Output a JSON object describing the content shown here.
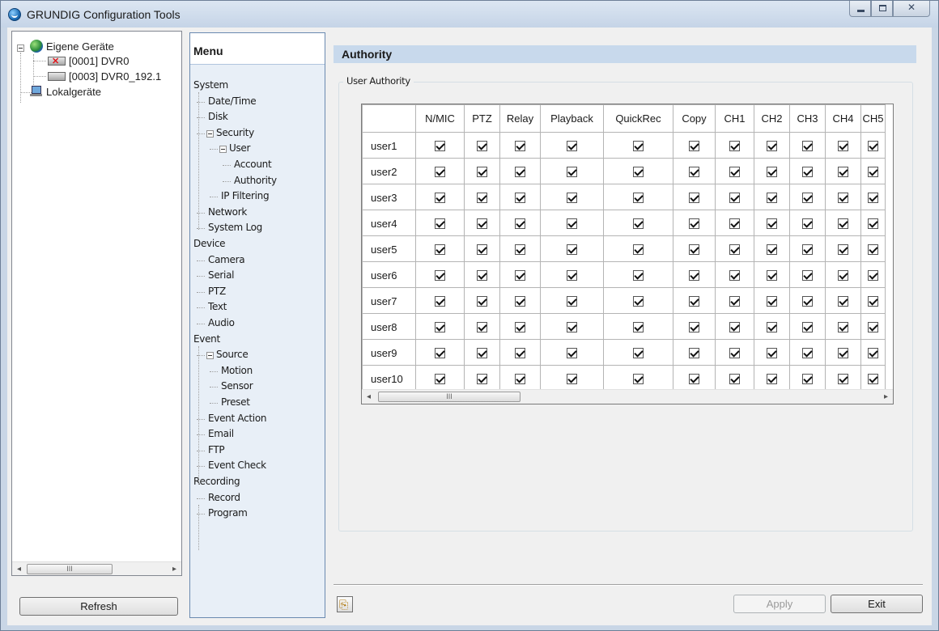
{
  "window": {
    "title": "GRUNDIG Configuration Tools"
  },
  "device_tree": {
    "root": "Eigene Geräte",
    "devices": [
      {
        "label": "[0001] DVR0",
        "status": "error"
      },
      {
        "label": "[0003] DVR0_192.1",
        "status": "ok"
      }
    ],
    "local": "Lokalgeräte",
    "scroll_thumb": "III",
    "refresh_label": "Refresh"
  },
  "menu": {
    "header": "Menu",
    "items": [
      {
        "label": "System",
        "level": 0
      },
      {
        "label": "Date/Time",
        "level": 1
      },
      {
        "label": "Disk",
        "level": 1
      },
      {
        "label": "Security",
        "level": 1
      },
      {
        "label": "User",
        "level": 2
      },
      {
        "label": "Account",
        "level": 3
      },
      {
        "label": "Authority",
        "level": 3
      },
      {
        "label": "IP Filtering",
        "level": 2
      },
      {
        "label": "Network",
        "level": 1
      },
      {
        "label": "System Log",
        "level": 1
      },
      {
        "label": "Device",
        "level": 0
      },
      {
        "label": "Camera",
        "level": 1
      },
      {
        "label": "Serial",
        "level": 1
      },
      {
        "label": "PTZ",
        "level": 1
      },
      {
        "label": "Text",
        "level": 1
      },
      {
        "label": "Audio",
        "level": 1
      },
      {
        "label": "Event",
        "level": 0
      },
      {
        "label": "Source",
        "level": 1
      },
      {
        "label": "Motion",
        "level": 2
      },
      {
        "label": "Sensor",
        "level": 2
      },
      {
        "label": "Preset",
        "level": 2
      },
      {
        "label": "Event Action",
        "level": 1
      },
      {
        "label": "Email",
        "level": 1
      },
      {
        "label": "FTP",
        "level": 1
      },
      {
        "label": "Event Check",
        "level": 1
      },
      {
        "label": "Recording",
        "level": 0
      },
      {
        "label": "Record",
        "level": 1
      },
      {
        "label": "Program",
        "level": 1
      }
    ]
  },
  "content": {
    "header": "Authority",
    "group_label": "User Authority",
    "columns": [
      "N/MIC",
      "PTZ",
      "Relay",
      "Playback",
      "QuickRec",
      "Copy",
      "CH1",
      "CH2",
      "CH3",
      "CH4",
      "CH5"
    ],
    "rows": [
      {
        "user": "user1",
        "checked": [
          true,
          true,
          true,
          true,
          true,
          true,
          true,
          true,
          true,
          true,
          true
        ]
      },
      {
        "user": "user2",
        "checked": [
          true,
          true,
          true,
          true,
          true,
          true,
          true,
          true,
          true,
          true,
          true
        ]
      },
      {
        "user": "user3",
        "checked": [
          true,
          true,
          true,
          true,
          true,
          true,
          true,
          true,
          true,
          true,
          true
        ]
      },
      {
        "user": "user4",
        "checked": [
          true,
          true,
          true,
          true,
          true,
          true,
          true,
          true,
          true,
          true,
          true
        ]
      },
      {
        "user": "user5",
        "checked": [
          true,
          true,
          true,
          true,
          true,
          true,
          true,
          true,
          true,
          true,
          true
        ]
      },
      {
        "user": "user6",
        "checked": [
          true,
          true,
          true,
          true,
          true,
          true,
          true,
          true,
          true,
          true,
          true
        ]
      },
      {
        "user": "user7",
        "checked": [
          true,
          true,
          true,
          true,
          true,
          true,
          true,
          true,
          true,
          true,
          true
        ]
      },
      {
        "user": "user8",
        "checked": [
          true,
          true,
          true,
          true,
          true,
          true,
          true,
          true,
          true,
          true,
          true
        ]
      },
      {
        "user": "user9",
        "checked": [
          true,
          true,
          true,
          true,
          true,
          true,
          true,
          true,
          true,
          true,
          true
        ]
      },
      {
        "user": "user10",
        "checked": [
          true,
          true,
          true,
          true,
          true,
          true,
          true,
          true,
          true,
          true,
          true
        ]
      }
    ],
    "scroll_thumb": "III"
  },
  "buttons": {
    "apply_label": "Apply",
    "exit_label": "Exit"
  },
  "icons": {
    "app": "grundig-logo-icon",
    "export": "export-icon"
  }
}
